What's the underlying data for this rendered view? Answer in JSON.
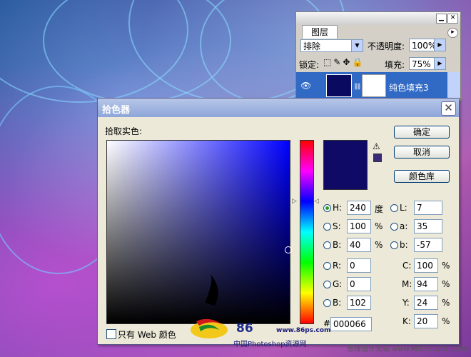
{
  "layers_panel": {
    "tab": "图层",
    "blend_mode": "排除",
    "opacity_label": "不透明度:",
    "opacity": "100%",
    "lock_label": "锁定:",
    "fill_label": "填充:",
    "fill": "75%",
    "layer_name": "纯色填充3"
  },
  "dialog": {
    "title": "拾色器",
    "pick_label": "拾取实色:",
    "ok": "确定",
    "cancel": "取消",
    "color_library": "颜色库",
    "only_web": "只有 Web 颜色",
    "new_color": "#0F0A66",
    "fields": {
      "H": {
        "label": "H:",
        "value": "240",
        "unit": "度"
      },
      "S": {
        "label": "S:",
        "value": "100",
        "unit": "%"
      },
      "Bri": {
        "label": "B:",
        "value": "40",
        "unit": "%"
      },
      "R": {
        "label": "R:",
        "value": "0"
      },
      "G": {
        "label": "G:",
        "value": "0"
      },
      "Blu": {
        "label": "B:",
        "value": "102"
      },
      "hash": "#",
      "hex": "000066",
      "L": {
        "label": "L:",
        "value": "7"
      },
      "a": {
        "label": "a:",
        "value": "35"
      },
      "b": {
        "label": "b:",
        "value": "-57"
      },
      "C": {
        "label": "C:",
        "value": "100",
        "unit": "%"
      },
      "M": {
        "label": "M:",
        "value": "94",
        "unit": "%"
      },
      "Y": {
        "label": "Y:",
        "value": "24",
        "unit": "%"
      },
      "K": {
        "label": "K:",
        "value": "20",
        "unit": "%"
      }
    }
  },
  "watermarks": {
    "logo_num": "86",
    "logo_url": "www.86ps.com",
    "logo_cn": "中国Photoshop资源网",
    "footer": "思缘设计论坛 www.MISSYUAN.COM"
  }
}
